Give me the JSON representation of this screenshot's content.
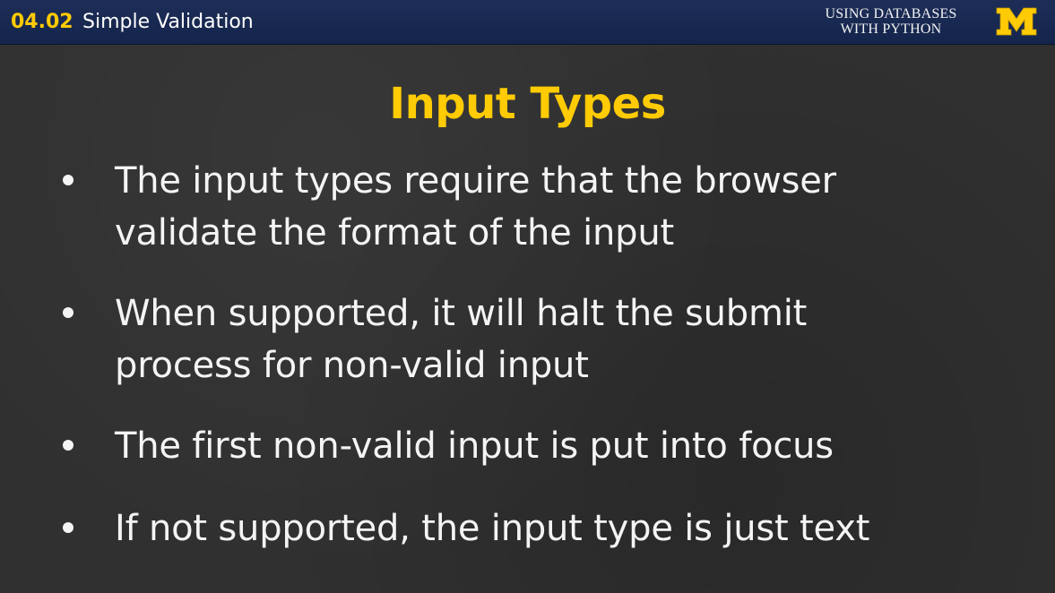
{
  "header": {
    "lesson_number": "04.02",
    "lesson_title": "Simple Validation",
    "course_line1": "USING DATABASES",
    "course_line2": "WITH PYTHON",
    "logo_letter": "M",
    "logo_icon": "university-m-logo",
    "colors": {
      "bar": "#1a2a52",
      "accent": "#ffcb05"
    }
  },
  "slide": {
    "title": "Input Types",
    "bullets": [
      {
        "line1": "The input types require that the browser",
        "line2": "validate the format of the input"
      },
      {
        "line1": "When supported, it will halt the submit",
        "line2": "process for non-valid input"
      },
      {
        "line1": "The first non-valid input is put into focus"
      },
      {
        "line1": "If not supported, the input type is just text"
      }
    ],
    "colors": {
      "background": "#303030",
      "title": "#ffcb05",
      "text": "#f4f4f4"
    }
  }
}
